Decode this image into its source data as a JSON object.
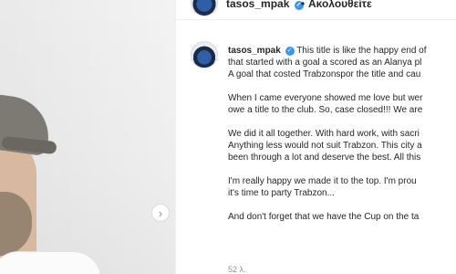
{
  "header": {
    "username": "tasos_mpak",
    "verified_symbol": "✓",
    "separator": "•",
    "follow_label": "Ακολουθείτε"
  },
  "post": {
    "username": "tasos_mpak",
    "verified_symbol": "✓",
    "paragraphs": [
      [
        "This title is like the happy end of",
        "that started with a goal a scored as an Alanya pl",
        "A goal that costed Trabzonspor the title and cau"
      ],
      [
        "When I came everyone showed me love but wer",
        "owe a title to the club. So, case closed!!! We are"
      ],
      [
        "We did it all together. With hard work, with sacri",
        "Anything less would not suit Trabzon. This city a",
        "been through a lot and deserve the best. All this"
      ],
      [
        "I'm really happy we made it to the top. I'm prou",
        "it's time to party Trabzon..."
      ],
      [
        "And don't forget that we have the Cup on the ta"
      ]
    ],
    "time_ago": "52 λ."
  },
  "carousel": {
    "next_icon": "›"
  },
  "icons": {
    "avatar": "avatar-icon",
    "verified": "verified-badge-icon",
    "next": "chevron-right-icon"
  },
  "colors": {
    "verified": "#3897f0",
    "text": "#262626",
    "muted": "#8e8e8e",
    "border": "#efefef"
  }
}
